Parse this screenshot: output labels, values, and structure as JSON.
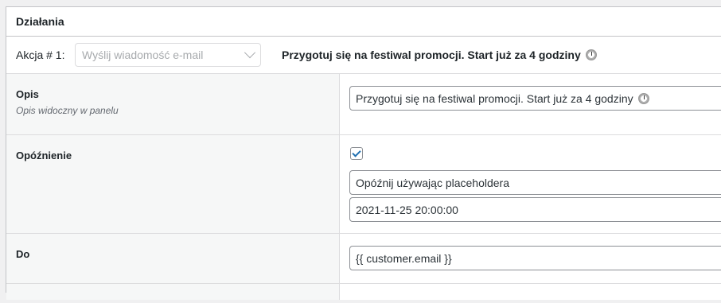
{
  "panel": {
    "title": "Działania"
  },
  "action": {
    "label": "Akcja # 1:",
    "select_value": "Wyślij wiadomość e-mail",
    "title": "Przygotuj się na festiwal promocji. Start już za 4 godziny"
  },
  "fields": {
    "description": {
      "label": "Opis",
      "help": "Opis widoczny w panelu",
      "value": "Przygotuj się na festiwal promocji. Start już za 4 godziny"
    },
    "delay": {
      "label": "Opóźnienie",
      "checked": true,
      "mode_value": "Opóźnij używając placeholdera",
      "datetime_value": "2021-11-25 20:00:00"
    },
    "to": {
      "label": "Do",
      "value": "{{ customer.email }}"
    }
  }
}
